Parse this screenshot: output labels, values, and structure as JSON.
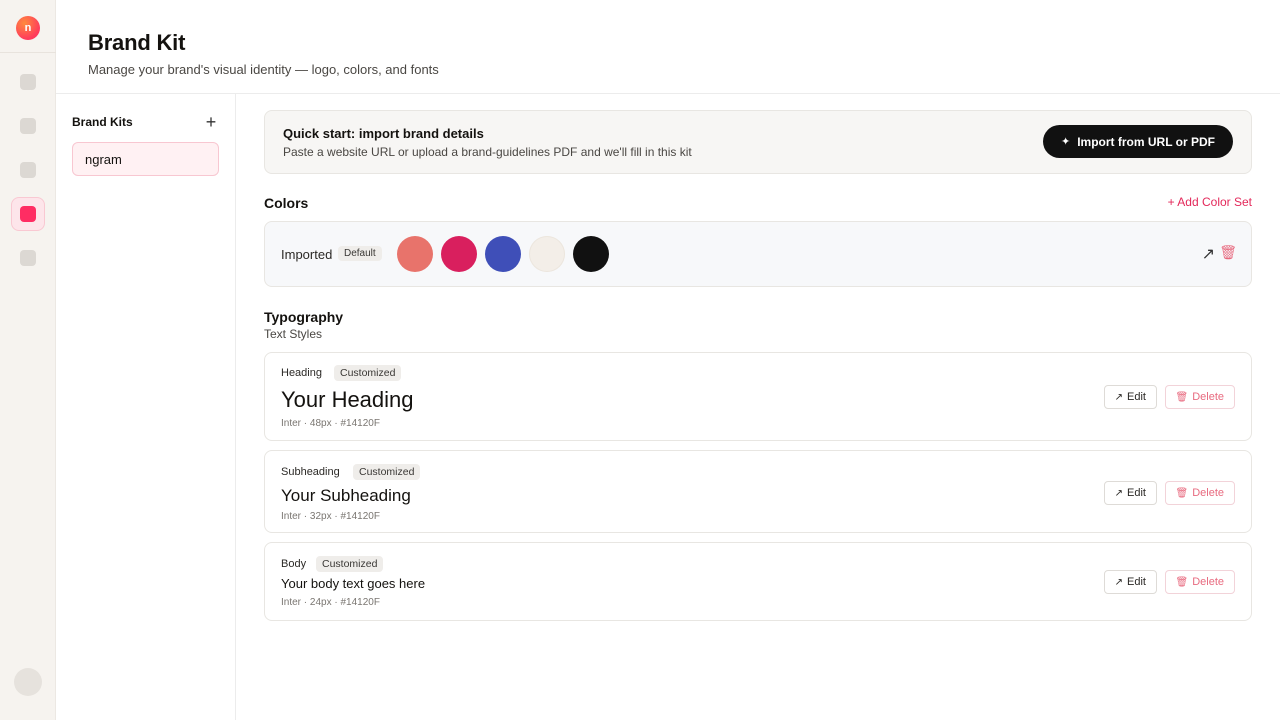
{
  "header": {
    "title": "Brand Kit",
    "subtitle": "Manage your brand's visual identity — logo, colors, and fonts"
  },
  "rail": {
    "logo_letter": "n"
  },
  "kits": {
    "title": "Brand Kits",
    "add_icon": "+",
    "items": [
      {
        "label": "ngram"
      }
    ]
  },
  "quick_start": {
    "title": "Quick start: import brand details",
    "description": "Paste a website URL or upload a brand-guidelines PDF and we'll fill in this kit",
    "button_label": "Import from URL or PDF",
    "button_icon": "✦"
  },
  "colors": {
    "title": "Colors",
    "add_label": "+ Add Color Set",
    "sets": [
      {
        "name": "Imported",
        "tag": "Default",
        "swatches": [
          "#e8736b",
          "#d91f5e",
          "#3f4fb8",
          "#f3eee8",
          "#111111"
        ]
      }
    ]
  },
  "typography": {
    "title": "Typography",
    "subtitle": "Text Styles",
    "styles": [
      {
        "label": "Heading",
        "tag": "Customized",
        "sample": "Your Heading",
        "meta": "Inter · 48px · #14120F",
        "edit": "Edit",
        "delete": "Delete"
      },
      {
        "label": "Subheading",
        "tag": "Customized",
        "sample": "Your Subheading",
        "meta": "Inter · 32px · #14120F",
        "edit": "Edit",
        "delete": "Delete"
      },
      {
        "label": "Body",
        "tag": "Customized",
        "sample": "Your body text goes here",
        "meta": "Inter · 24px · #14120F",
        "edit": "Edit",
        "delete": "Delete"
      }
    ]
  },
  "theme": {
    "accent": "#e3285a",
    "active_nav": "#ff2d63",
    "text": "#14120F"
  }
}
